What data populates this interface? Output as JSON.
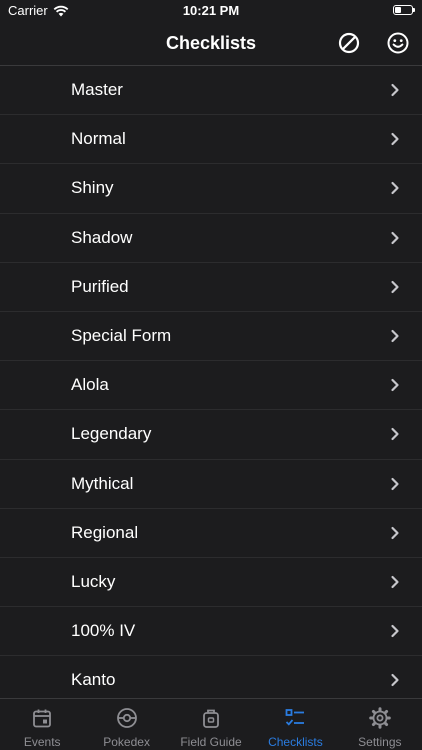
{
  "status_bar": {
    "carrier": "Carrier",
    "time": "10:21 PM"
  },
  "nav": {
    "title": "Checklists",
    "left_action_icon": "prohibited-icon",
    "right_action_icon": "smiley-icon"
  },
  "checklists": [
    {
      "label": "Master"
    },
    {
      "label": "Normal"
    },
    {
      "label": "Shiny"
    },
    {
      "label": "Shadow"
    },
    {
      "label": "Purified"
    },
    {
      "label": "Special Form"
    },
    {
      "label": "Alola"
    },
    {
      "label": "Legendary"
    },
    {
      "label": "Mythical"
    },
    {
      "label": "Regional"
    },
    {
      "label": "Lucky"
    },
    {
      "label": "100% IV"
    },
    {
      "label": "Kanto"
    }
  ],
  "tabs": [
    {
      "label": "Events",
      "icon": "calendar-icon",
      "active": false
    },
    {
      "label": "Pokedex",
      "icon": "pokeball-icon",
      "active": false
    },
    {
      "label": "Field Guide",
      "icon": "backpack-icon",
      "active": false
    },
    {
      "label": "Checklists",
      "icon": "checklist-icon",
      "active": true
    },
    {
      "label": "Settings",
      "icon": "gear-icon",
      "active": false
    }
  ],
  "colors": {
    "accent": "#2a7ce0",
    "background": "#1c1c1e",
    "inactive_tab": "#8e8e93"
  }
}
